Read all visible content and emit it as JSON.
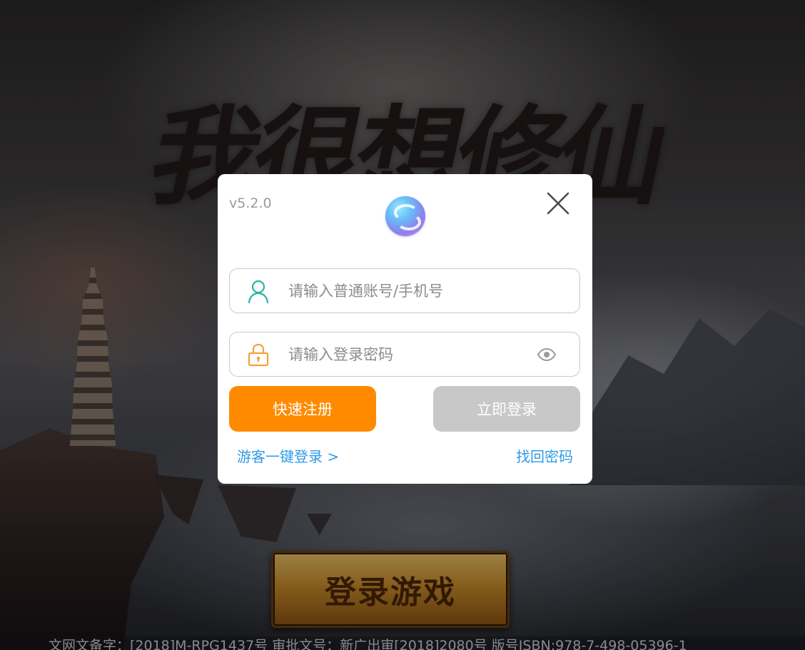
{
  "background": {
    "title_art": "我很想修仙",
    "enter_button_label": "登录游戏",
    "footer_text": "文网文备字：[2018]M-RPG1437号   审批文号：新广出审[2018]2080号   版号ISBN:978-7-498-05396-1"
  },
  "dialog": {
    "version": "v5.2.0",
    "account_placeholder": "请输入普通账号/手机号",
    "password_placeholder": "请输入登录密码",
    "register_label": "快速注册",
    "login_label": "立即登录",
    "guest_login_link": "游客一键登录 >",
    "recover_password_link": "找回密码"
  },
  "colors": {
    "accent_orange": "#ff8a00",
    "disabled_gray": "#c8c8c8",
    "link_blue": "#2f9be6",
    "user_icon_teal": "#26b5a4",
    "lock_icon_orange": "#f3a23a"
  },
  "icons": [
    "app-logo-icon",
    "close-icon",
    "user-icon",
    "lock-icon",
    "eye-icon"
  ]
}
